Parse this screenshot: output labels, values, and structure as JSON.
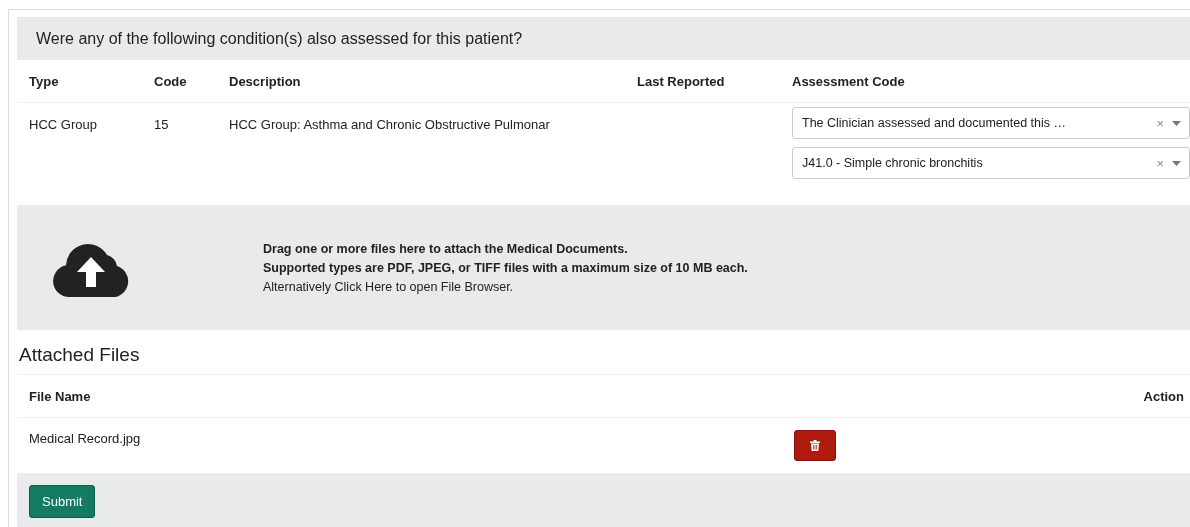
{
  "question": "Were any of the following condition(s) also assessed for this patient?",
  "columns": [
    "Type",
    "Code",
    "Description",
    "Last Reported",
    "Assessment Code"
  ],
  "rows": [
    {
      "type": "HCC Group",
      "code": "15",
      "description": "HCC Group: Asthma and Chronic Obstructive Pulmonar",
      "assessments": [
        {
          "value": "The Clinician assessed and documented this …",
          "clear": "×"
        },
        {
          "value": "J41.0 - Simple chronic bronchitis",
          "clear": "×"
        }
      ]
    }
  ],
  "upload": {
    "lines": [
      "Drag one or more files here to attach the Medical Documents.",
      "Supported types are PDF, JPEG, or TIFF files with a maximum size of 10 MB each."
    ],
    "link": "Alternatively Click Here to open File Browser."
  },
  "attached_title": "Attached Files",
  "file_columns": [
    "File Name",
    "Action"
  ],
  "files": [
    {
      "name": "Medical Record.jpg"
    }
  ],
  "submit": "Submit"
}
